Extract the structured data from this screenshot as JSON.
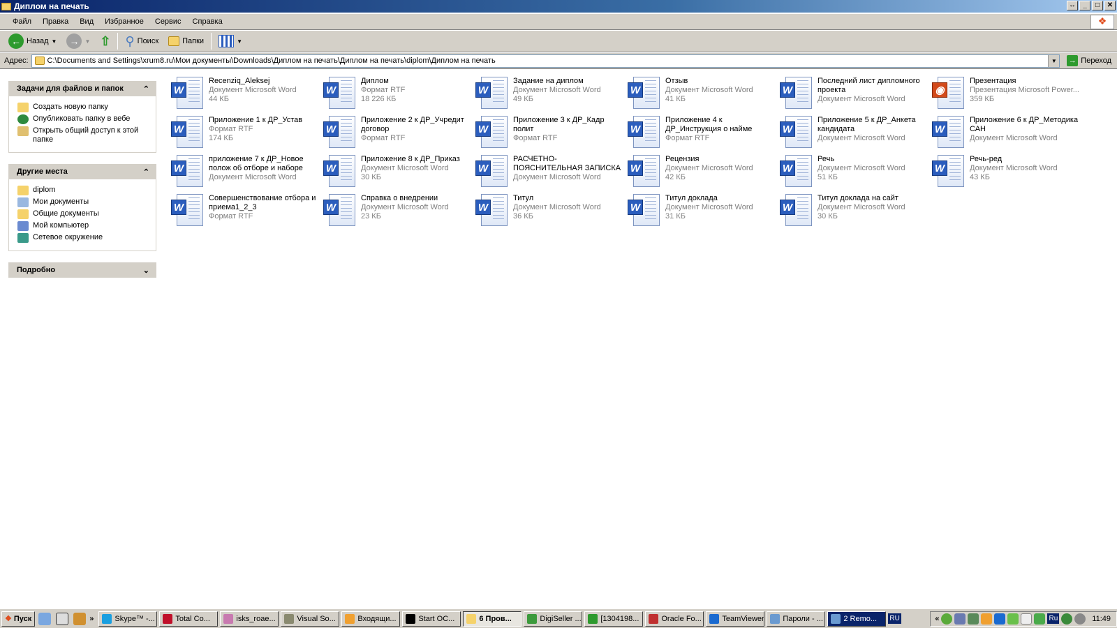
{
  "window": {
    "title": "Диплом на печать",
    "controls": [
      "↔",
      "_",
      "□",
      "✕"
    ]
  },
  "menu": [
    "Файл",
    "Правка",
    "Вид",
    "Избранное",
    "Сервис",
    "Справка"
  ],
  "toolbar": {
    "back": "Назад",
    "search": "Поиск",
    "folders": "Папки"
  },
  "address": {
    "label": "Адрес:",
    "path": "C:\\Documents and Settings\\xrum8.ru\\Мои документы\\Downloads\\Диплом на печать\\Диплом на печать\\diplom\\Диплом на печать",
    "go": "Переход"
  },
  "sidebar": {
    "tasks": {
      "title": "Задачи для файлов и папок",
      "items": [
        "Создать новую папку",
        "Опубликовать папку в вебе",
        "Открыть общий доступ к этой папке"
      ]
    },
    "places": {
      "title": "Другие места",
      "items": [
        "diplom",
        "Мои документы",
        "Общие документы",
        "Мой компьютер",
        "Сетевое окружение"
      ]
    },
    "details": {
      "title": "Подробно"
    }
  },
  "files": [
    {
      "name": "Recenziq_Aleksej",
      "type": "Документ Microsoft Word",
      "size": "44 КБ",
      "kind": "word"
    },
    {
      "name": "Диплом",
      "type": "Формат RTF",
      "size": "18 226 КБ",
      "kind": "word"
    },
    {
      "name": "Задание на диплом",
      "type": "Документ Microsoft Word",
      "size": "49 КБ",
      "kind": "word"
    },
    {
      "name": "Отзыв",
      "type": "Документ Microsoft Word",
      "size": "41 КБ",
      "kind": "word"
    },
    {
      "name": "Последний лист дипломного проекта",
      "type": "Документ Microsoft Word",
      "size": "",
      "kind": "word"
    },
    {
      "name": "Презентация",
      "type": "Презентация Microsoft Power...",
      "size": "359 КБ",
      "kind": "ppt"
    },
    {
      "name": "Приложение 1 к ДР_Устав",
      "type": "Формат RTF",
      "size": "174 КБ",
      "kind": "word"
    },
    {
      "name": "Приложение 2 к ДР_Учредит договор",
      "type": "Формат RTF",
      "size": "",
      "kind": "word"
    },
    {
      "name": "Приложение 3 к ДР_Кадр полит",
      "type": "Формат RTF",
      "size": "",
      "kind": "word"
    },
    {
      "name": "Приложение 4 к ДР_Инструкция о найме",
      "type": "Формат RTF",
      "size": "",
      "kind": "word"
    },
    {
      "name": "Приложение 5 к ДР_Анкета кандидата",
      "type": "Документ Microsoft Word",
      "size": "",
      "kind": "word"
    },
    {
      "name": "Приложение 6 к ДР_Методика САН",
      "type": "Документ Microsoft Word",
      "size": "",
      "kind": "word"
    },
    {
      "name": "приложение 7 к ДР_Новое полож об отборе и наборе",
      "type": "Документ Microsoft Word",
      "size": "",
      "kind": "word"
    },
    {
      "name": "Приложение 8 к ДР_Приказ",
      "type": "Документ Microsoft Word",
      "size": "30 КБ",
      "kind": "word"
    },
    {
      "name": "РАСЧЕТНО-ПОЯСНИТЕЛЬНАЯ ЗАПИСКА",
      "type": "Документ Microsoft Word",
      "size": "",
      "kind": "word"
    },
    {
      "name": "Рецензия",
      "type": "Документ Microsoft Word",
      "size": "42 КБ",
      "kind": "word"
    },
    {
      "name": "Речь",
      "type": "Документ Microsoft Word",
      "size": "51 КБ",
      "kind": "word"
    },
    {
      "name": "Речь-ред",
      "type": "Документ Microsoft Word",
      "size": "43 КБ",
      "kind": "word"
    },
    {
      "name": "Совершенствование отбора и приема1_2_3",
      "type": "Формат RTF",
      "size": "",
      "kind": "word"
    },
    {
      "name": "Справка о внедрении",
      "type": "Документ Microsoft Word",
      "size": "23 КБ",
      "kind": "word"
    },
    {
      "name": "Титул",
      "type": "Документ Microsoft Word",
      "size": "36 КБ",
      "kind": "word"
    },
    {
      "name": "Титул доклада",
      "type": "Документ Microsoft Word",
      "size": "31 КБ",
      "kind": "word"
    },
    {
      "name": "Титул доклада на сайт",
      "type": "Документ Microsoft Word",
      "size": "30 КБ",
      "kind": "word"
    }
  ],
  "taskbar": {
    "start": "Пуск",
    "chevron": "»",
    "tasks": [
      {
        "label": "Skype™ -...",
        "color": "#1a9fe0"
      },
      {
        "label": "Total Co...",
        "color": "#c0102a"
      },
      {
        "label": "isks_roae...",
        "color": "#c87ab0"
      },
      {
        "label": "Visual So...",
        "color": "#8a8a70"
      },
      {
        "label": "Входящи...",
        "color": "#f0a030"
      },
      {
        "label": "Start OC...",
        "color": "#000000"
      },
      {
        "label": "6 Пров...",
        "color": "#f5d26b",
        "active": true
      },
      {
        "label": "DigiSeller ...",
        "color": "#3c9a3c"
      },
      {
        "label": "[1304198...",
        "color": "#2e9a2e"
      },
      {
        "label": "Oracle Fo...",
        "color": "#c03030"
      },
      {
        "label": "TeamViewer",
        "color": "#1a6ad0"
      },
      {
        "label": "Пароли - ...",
        "color": "#6a9ad0"
      },
      {
        "label": "2 Remo...",
        "color": "#6a9ad0",
        "dark": true
      }
    ],
    "lang": "RU",
    "tray_chevron": "«",
    "tray_lang": "Ru",
    "clock": "11:49"
  }
}
